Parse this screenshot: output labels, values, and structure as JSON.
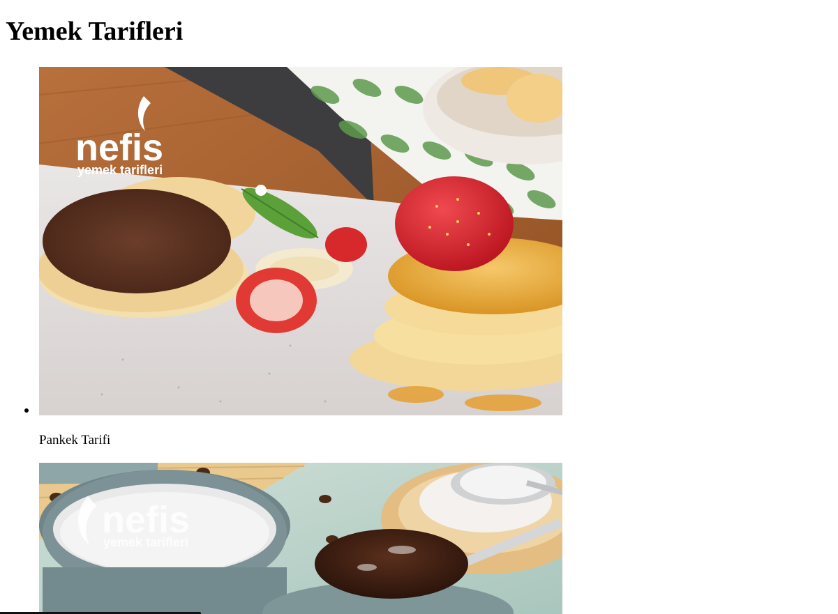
{
  "page": {
    "title": "Yemek Tarifleri"
  },
  "recipes": [
    {
      "caption": "Pankek Tarifi",
      "image": {
        "logo_main": "nefis",
        "logo_sub": "yemek tarifleri"
      }
    },
    {
      "caption": "",
      "image": {
        "logo_main": "nefis",
        "logo_sub": "yemek tarifleri"
      }
    }
  ]
}
